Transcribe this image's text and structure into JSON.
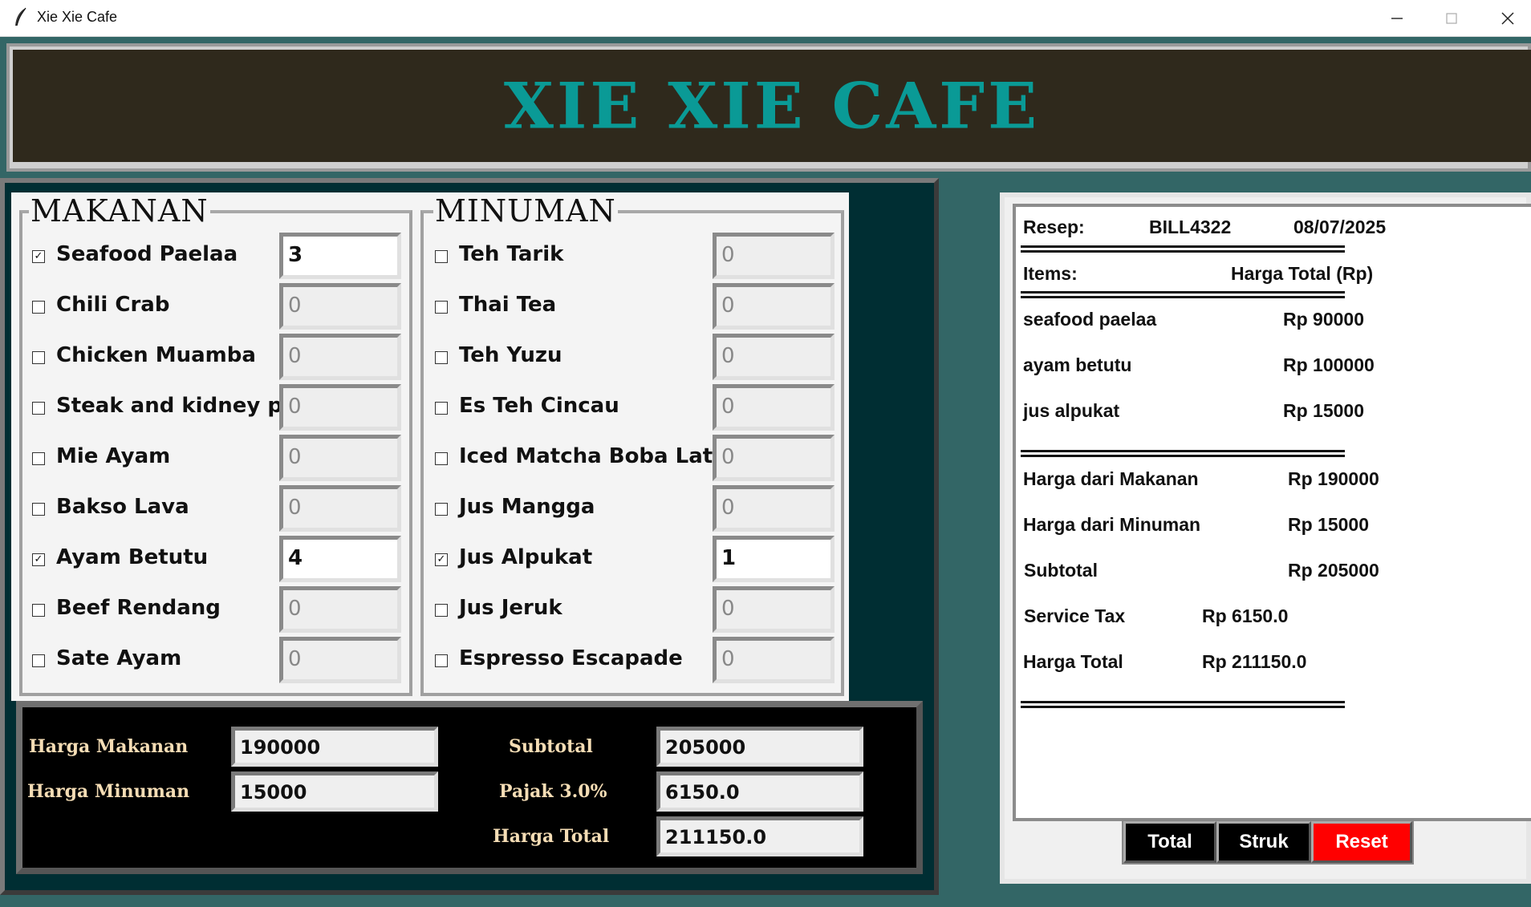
{
  "window": {
    "title": "Xie Xie Cafe",
    "controls": [
      "minimize",
      "maximize",
      "close"
    ]
  },
  "banner": {
    "title": "XIE XIE CAFE",
    "color": "#0a9a96",
    "background": "#2f291c"
  },
  "makanan": {
    "label": "MAKANAN",
    "items": [
      {
        "name": "Seafood Paelaa",
        "checked": true,
        "qty": "3"
      },
      {
        "name": "Chili Crab",
        "checked": false,
        "qty": "0"
      },
      {
        "name": "Chicken Muamba",
        "checked": false,
        "qty": "0"
      },
      {
        "name": "Steak and kidney pie",
        "checked": false,
        "qty": "0"
      },
      {
        "name": "Mie Ayam",
        "checked": false,
        "qty": "0"
      },
      {
        "name": "Bakso Lava",
        "checked": false,
        "qty": "0"
      },
      {
        "name": "Ayam Betutu",
        "checked": true,
        "qty": "4"
      },
      {
        "name": "Beef Rendang",
        "checked": false,
        "qty": "0"
      },
      {
        "name": "Sate Ayam",
        "checked": false,
        "qty": "0"
      }
    ]
  },
  "minuman": {
    "label": "MINUMAN",
    "items": [
      {
        "name": "Teh Tarik",
        "checked": false,
        "qty": "0"
      },
      {
        "name": "Thai Tea",
        "checked": false,
        "qty": "0"
      },
      {
        "name": "Teh Yuzu",
        "checked": false,
        "qty": "0"
      },
      {
        "name": "Es Teh Cincau",
        "checked": false,
        "qty": "0"
      },
      {
        "name": "Iced Matcha Boba Latte",
        "checked": false,
        "qty": "0"
      },
      {
        "name": "Jus Mangga",
        "checked": false,
        "qty": "0"
      },
      {
        "name": "Jus Alpukat",
        "checked": true,
        "qty": "1"
      },
      {
        "name": "Jus Jeruk",
        "checked": false,
        "qty": "0"
      },
      {
        "name": "Espresso Escapade",
        "checked": false,
        "qty": "0"
      }
    ]
  },
  "costs": {
    "harga_makanan_label": "Harga Makanan",
    "harga_makanan": "190000",
    "harga_minuman_label": "Harga Minuman",
    "harga_minuman": "15000",
    "subtotal_label": "Subtotal",
    "subtotal": "205000",
    "pajak_label": "Pajak 3.0%",
    "pajak": "6150.0",
    "harga_total_label": "Harga Total",
    "harga_total": "211150.0"
  },
  "receipt": {
    "resep_label": "Resep:",
    "bill_no": "BILL4322",
    "date": "08/07/2025",
    "items_label": "Items:",
    "harga_total_header": "Harga Total (Rp)",
    "lines": [
      {
        "item": "seafood paelaa",
        "price": "Rp 90000"
      },
      {
        "item": "ayam betutu",
        "price": "Rp 100000"
      },
      {
        "item": "jus alpukat",
        "price": "Rp 15000"
      }
    ],
    "summary": [
      {
        "label": "Harga dari Makanan",
        "value": "Rp 190000"
      },
      {
        "label": "Harga dari Minuman",
        "value": "Rp 15000"
      },
      {
        "label": "Subtotal",
        "value": "Rp 205000"
      },
      {
        "label": "Service Tax",
        "value": "Rp 6150.0"
      },
      {
        "label": "Harga Total",
        "value": "Rp 211150.0"
      }
    ]
  },
  "buttons": {
    "total": "Total",
    "struk": "Struk",
    "reset": "Reset",
    "reset_color": "#ff0000"
  }
}
